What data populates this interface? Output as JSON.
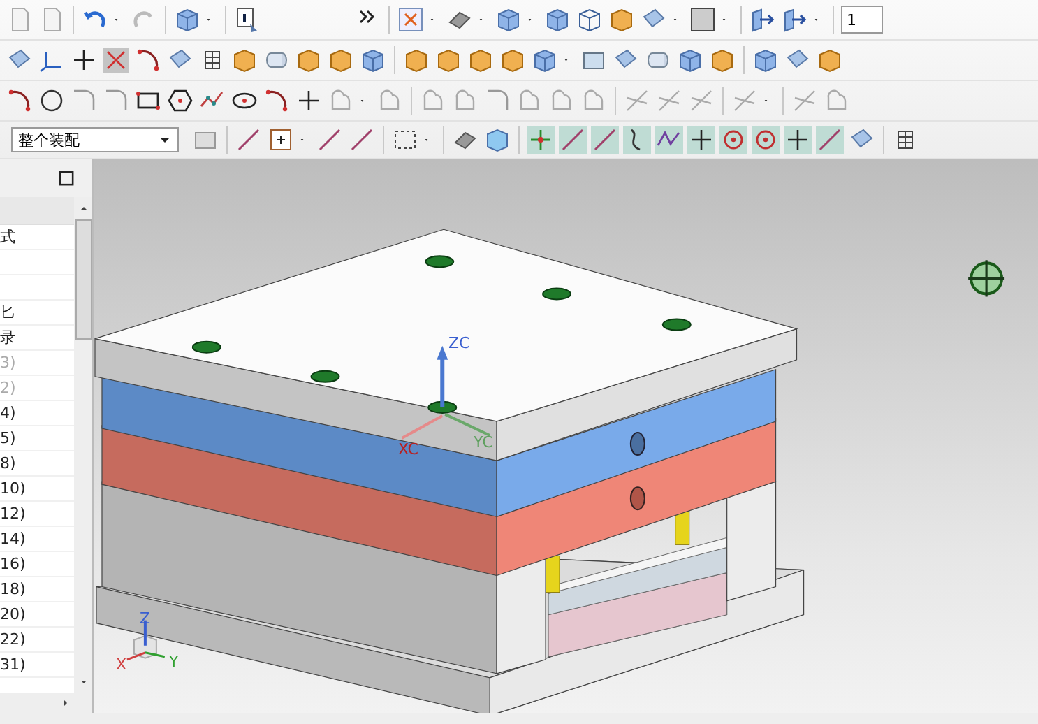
{
  "toolbar": {
    "layer_field": "1",
    "assembly_dropdown": "整个装配"
  },
  "navigator": {
    "items": [
      {
        "label": "式",
        "disabled": false
      },
      {
        "label": "匕",
        "disabled": false
      },
      {
        "label": "录",
        "disabled": false
      },
      {
        "label": "3)",
        "disabled": true
      },
      {
        "label": "2)",
        "disabled": true
      },
      {
        "label": "4)",
        "disabled": false
      },
      {
        "label": "5)",
        "disabled": false
      },
      {
        "label": "8)",
        "disabled": false
      },
      {
        "label": "10)",
        "disabled": false
      },
      {
        "label": "12)",
        "disabled": false
      },
      {
        "label": "14)",
        "disabled": false
      },
      {
        "label": "16)",
        "disabled": false
      },
      {
        "label": "18)",
        "disabled": false
      },
      {
        "label": "20)",
        "disabled": false
      },
      {
        "label": "22)",
        "disabled": false
      },
      {
        "label": "31)",
        "disabled": false
      }
    ]
  },
  "viewport": {
    "wcs_labels": {
      "z": "ZC",
      "x": "XC",
      "y": "YC"
    },
    "absolute_axes": {
      "z": "Z",
      "x": "X",
      "y": "Y"
    }
  }
}
